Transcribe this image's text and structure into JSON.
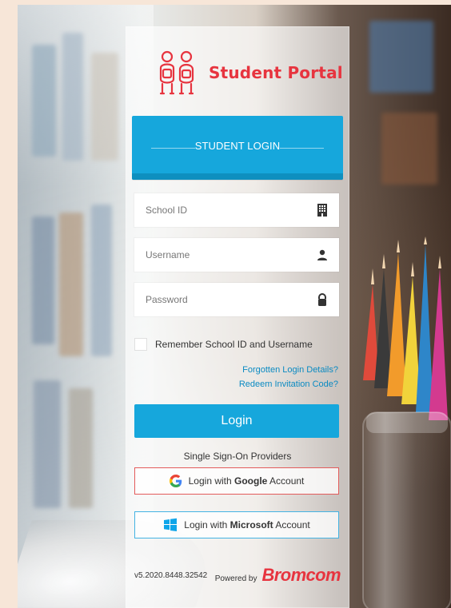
{
  "branding": {
    "title": "Student Portal",
    "icon": "students-icon",
    "color": "#e7343f"
  },
  "header": {
    "title": "STUDENT LOGIN",
    "color": "#16a7dc"
  },
  "form": {
    "school_id_placeholder": "School ID",
    "username_placeholder": "Username",
    "password_placeholder": "Password",
    "school_id_icon": "building-icon",
    "username_icon": "user-icon",
    "password_icon": "lock-icon",
    "remember_label": "Remember School ID and Username",
    "forgot_link": "Forgotten Login Details?",
    "redeem_link": "Redeem Invitation Code?",
    "login_button": "Login"
  },
  "sso": {
    "title": "Single Sign-On Providers",
    "google": {
      "prefix": "Login with ",
      "provider": "Google",
      "suffix": " Account",
      "icon": "google-icon",
      "border_color": "#e35b5b"
    },
    "microsoft": {
      "prefix": "Login with ",
      "provider": "Microsoft",
      "suffix": " Account",
      "icon": "windows-icon",
      "border_color": "#44b3e3"
    }
  },
  "footer": {
    "version": "v5.2020.8448.32542",
    "powered_by": "Powered by",
    "brand": "Bromcom"
  }
}
